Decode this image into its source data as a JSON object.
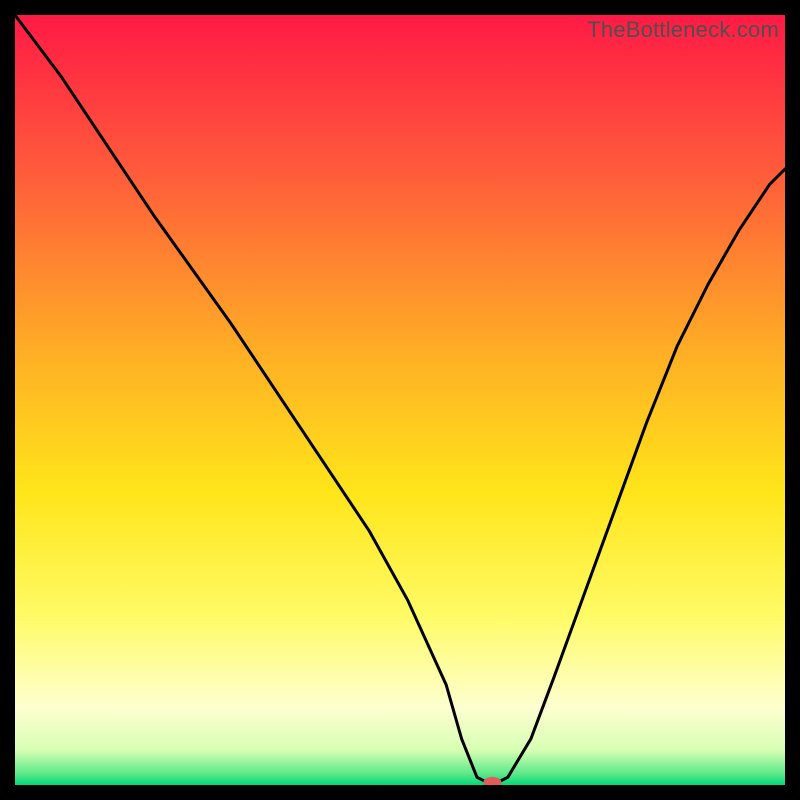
{
  "watermark": "TheBottleneck.com",
  "chart_data": {
    "type": "line",
    "title": "",
    "xlabel": "",
    "ylabel": "",
    "xlim": [
      0,
      100
    ],
    "ylim": [
      0,
      100
    ],
    "grid": false,
    "legend": false,
    "background_gradient": [
      {
        "pos": 0.0,
        "color": "#ff1a45"
      },
      {
        "pos": 0.2,
        "color": "#ff5a3b"
      },
      {
        "pos": 0.45,
        "color": "#ffb224"
      },
      {
        "pos": 0.62,
        "color": "#ffe51a"
      },
      {
        "pos": 0.78,
        "color": "#fffb66"
      },
      {
        "pos": 0.9,
        "color": "#fdffd0"
      },
      {
        "pos": 0.955,
        "color": "#d6ffb3"
      },
      {
        "pos": 0.985,
        "color": "#5fe88a"
      },
      {
        "pos": 1.0,
        "color": "#00d977"
      }
    ],
    "series": [
      {
        "name": "bottleneck-curve",
        "stroke": "#000000",
        "stroke_width": 3,
        "x": [
          0,
          6,
          12,
          18,
          23,
          28,
          34,
          40,
          46,
          51,
          56,
          58,
          60,
          62,
          64,
          67,
          70,
          74,
          78,
          82,
          86,
          90,
          94,
          98,
          100
        ],
        "values": [
          100,
          92,
          83,
          74,
          67,
          60,
          51,
          42,
          33,
          24,
          13,
          6,
          1,
          0,
          1,
          6,
          14,
          25,
          36,
          47,
          57,
          65,
          72,
          78,
          80
        ]
      }
    ],
    "marker": {
      "name": "optimal-point",
      "x": 62,
      "y": 0,
      "rx": 9,
      "ry": 5,
      "fill": "#e55a5a"
    }
  }
}
